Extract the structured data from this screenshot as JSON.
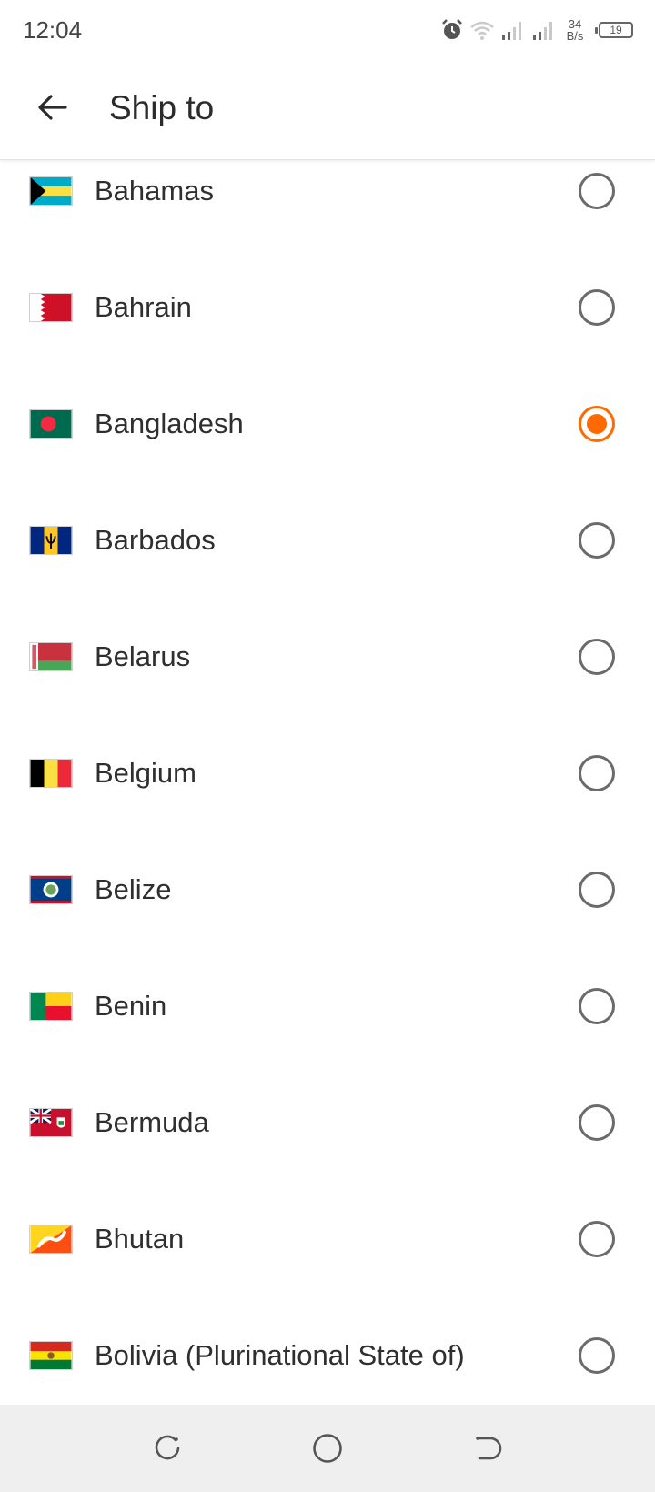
{
  "status": {
    "time": "12:04",
    "net_speed_value": "34",
    "net_speed_unit": "B/s",
    "battery": "19",
    "icons": [
      "alarm-icon",
      "wifi-icon",
      "signal-icon",
      "signal-icon"
    ]
  },
  "header": {
    "title": "Ship to",
    "back_icon": "arrow-left-icon"
  },
  "countries": [
    {
      "name": "Bahamas",
      "selected": false
    },
    {
      "name": "Bahrain",
      "selected": false
    },
    {
      "name": "Bangladesh",
      "selected": true
    },
    {
      "name": "Barbados",
      "selected": false
    },
    {
      "name": "Belarus",
      "selected": false
    },
    {
      "name": "Belgium",
      "selected": false
    },
    {
      "name": "Belize",
      "selected": false
    },
    {
      "name": "Benin",
      "selected": false
    },
    {
      "name": "Bermuda",
      "selected": false
    },
    {
      "name": "Bhutan",
      "selected": false
    },
    {
      "name": "Bolivia (Plurinational State of)",
      "selected": false
    }
  ],
  "accent_color": "#ff6a00",
  "nav": {
    "icons": [
      "recents-icon",
      "home-icon",
      "back-icon"
    ]
  }
}
